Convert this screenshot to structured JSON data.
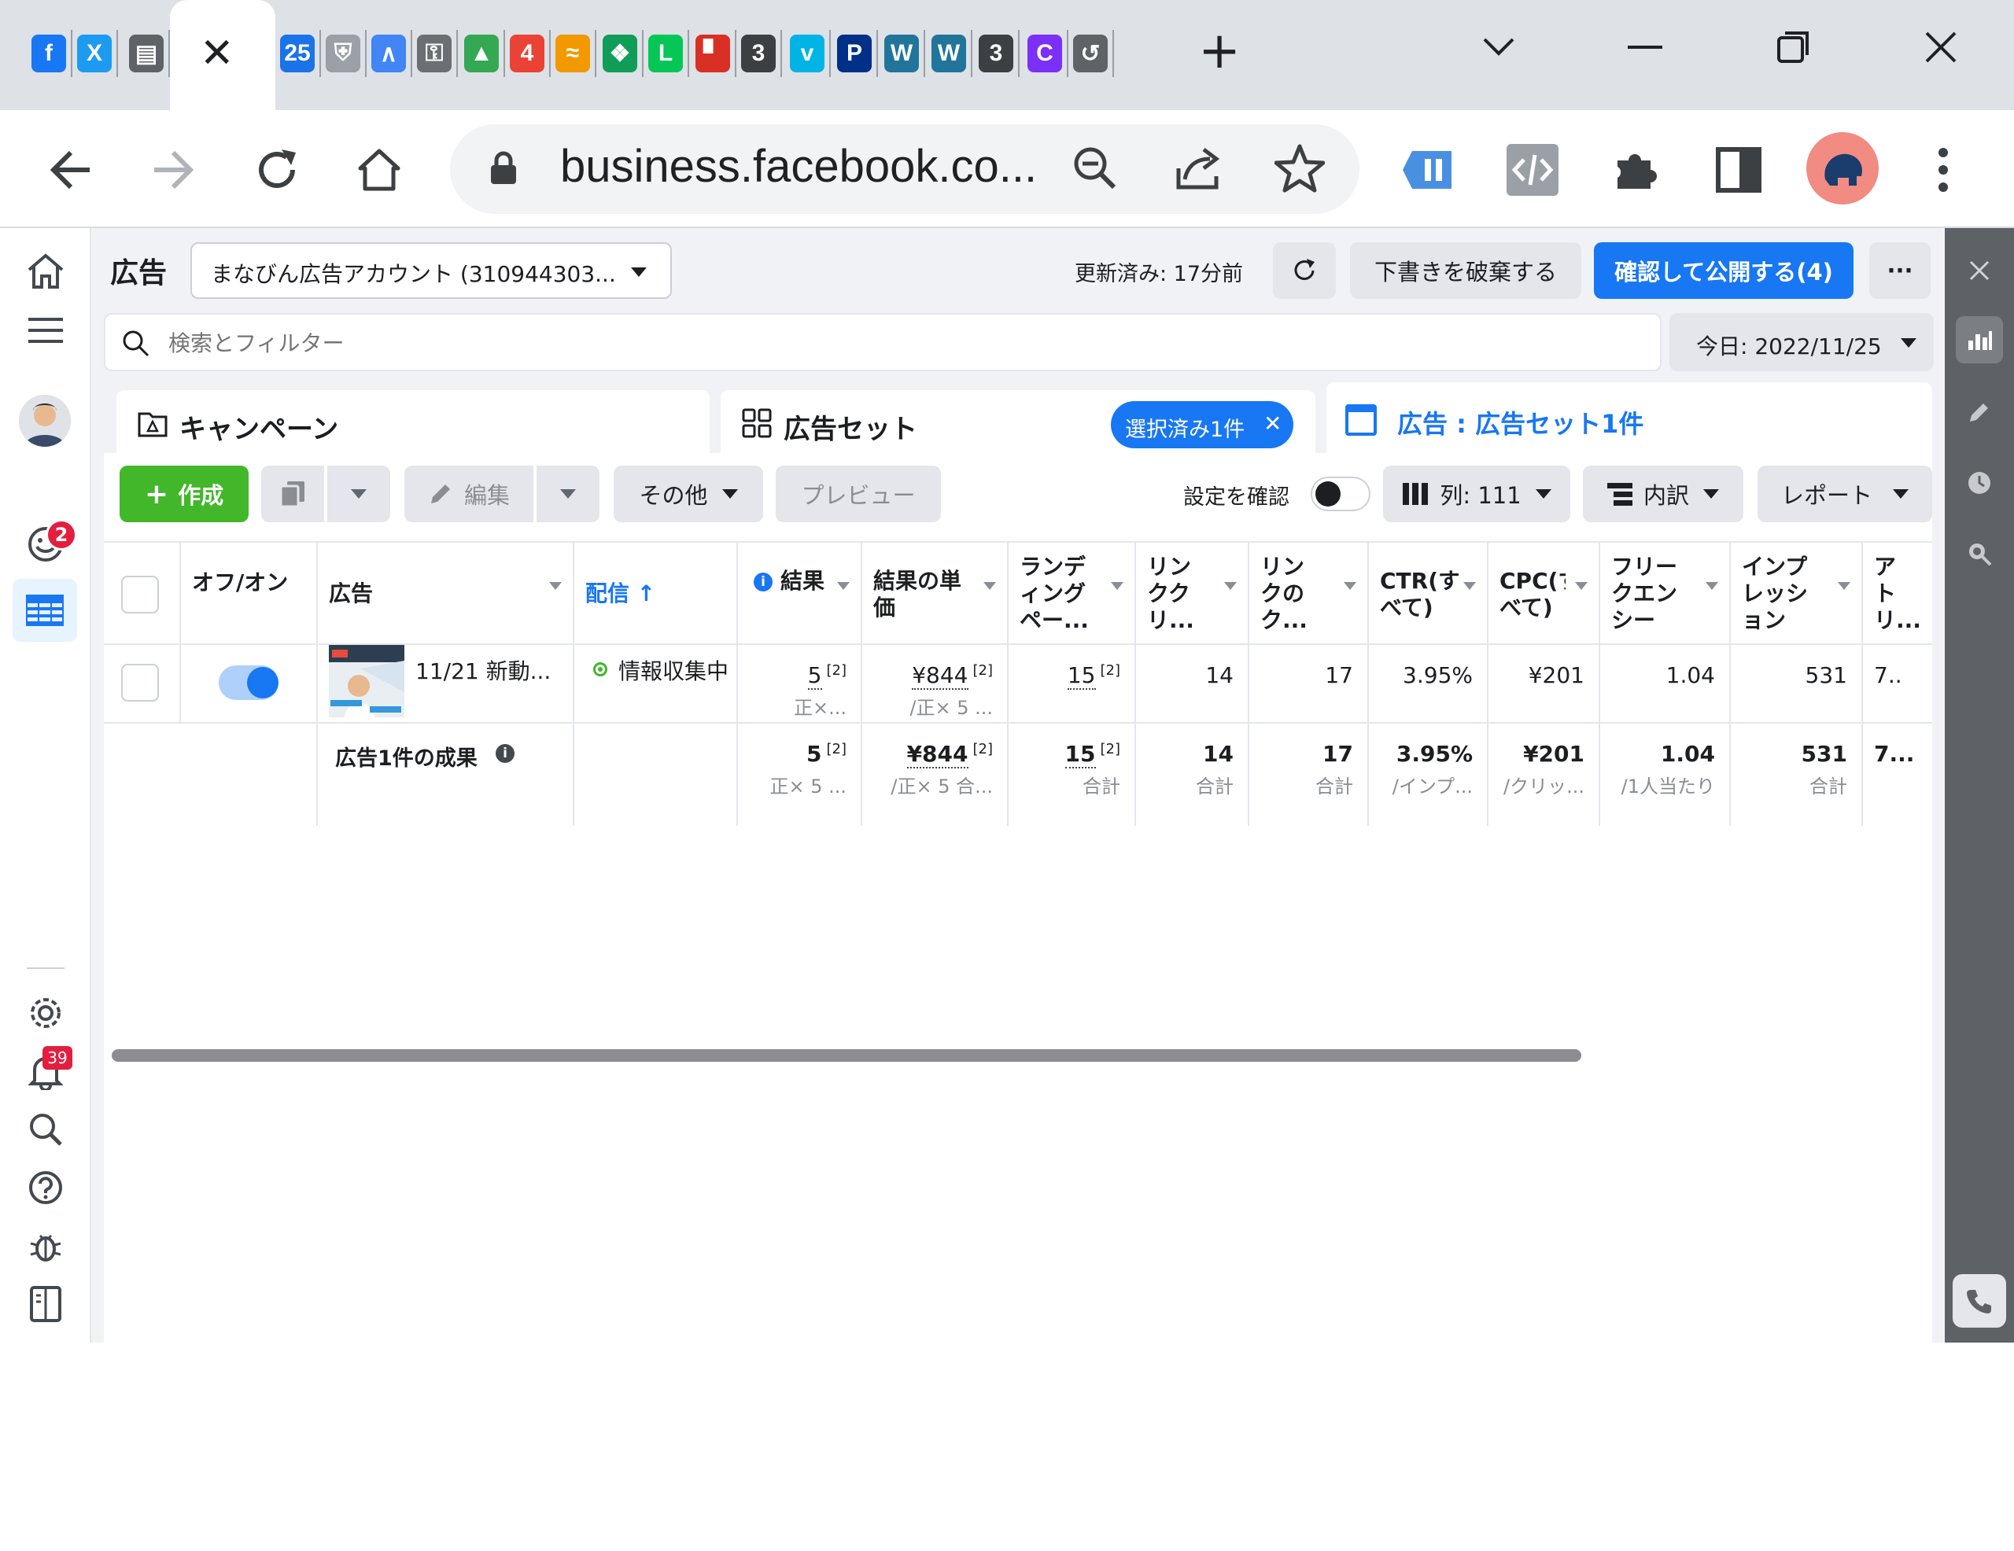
{
  "browser": {
    "url": "business.facebook.co...",
    "favicons": [
      "f",
      "X",
      "▤",
      "25",
      "⛨",
      "∧",
      "⚿",
      "▲",
      "4",
      "≈",
      "❖",
      "L",
      "▘",
      "3",
      "v",
      "P",
      "W",
      "W",
      "3",
      "C",
      "↺"
    ],
    "profile_color": "#f28b82"
  },
  "header": {
    "title": "広告",
    "account": "まなびん広告アカウント (310944303...",
    "updated": "更新済み: 17分前",
    "discard_label": "下書きを破棄する",
    "publish_label": "確認して公開する(4)",
    "more_label": "···"
  },
  "search": {
    "placeholder": "検索とフィルター",
    "date": "今日: 2022/11/25"
  },
  "tabs": {
    "campaign": "キャンペーン",
    "adset": "広告セット",
    "adset_selected": "選択済み1件",
    "ad": "広告 : 広告セット1件"
  },
  "toolbar": {
    "create": "作成",
    "edit": "編集",
    "other": "その他",
    "preview": "プレビュー",
    "review_settings": "設定を確認",
    "columns": "列: 111",
    "breakdown": "内訳",
    "report": "レポート"
  },
  "table": {
    "headers": {
      "onoff": "オフ/オン",
      "ad": "広告",
      "delivery": "配信 ↑",
      "results": "結果",
      "cpr": "結果の単価",
      "lpv": "ランディングペー...",
      "link_clicks": "リンククリ...",
      "link_click2": "リンクのク...",
      "ctr": "CTR(すべて)",
      "cpc": "CPC(すべて)",
      "frequency": "フリークエンシー",
      "impressions": "インプレッション",
      "attribution": "アトリ..."
    },
    "row": {
      "name": "11/21 新動...",
      "delivery": "情報収集中",
      "results": "5",
      "results_sub": "正×...",
      "cpr": "¥844",
      "cpr_sub": "/正× 5 ...",
      "lpv": "15",
      "link_clicks": "14",
      "link_click2": "17",
      "ctr": "3.95%",
      "cpc": "¥201",
      "frequency": "1.04",
      "impressions": "531",
      "attribution": "7..",
      "sup": "[2]"
    },
    "summary": {
      "label": "広告1件の成果",
      "results": "5",
      "results_sub": "正× 5 ...",
      "cpr": "¥844",
      "cpr_sub": "/正× 5 合...",
      "lpv": "15",
      "lpv_sub": "合計",
      "link_clicks": "14",
      "link_clicks_sub": "合計",
      "link_click2": "17",
      "link_click2_sub": "合計",
      "ctr": "3.95%",
      "ctr_sub": "/インプ...",
      "cpc": "¥201",
      "cpc_sub": "/クリッ...",
      "frequency": "1.04",
      "frequency_sub": "/1人当たり",
      "impressions": "531",
      "impressions_sub": "合計",
      "attribution": "7...",
      "sup": "[2]"
    }
  },
  "rail": {
    "notifications_badge": "2",
    "bell_badge": "39"
  },
  "colors": {
    "primary": "#1877f2",
    "create_green": "#42b72a"
  }
}
